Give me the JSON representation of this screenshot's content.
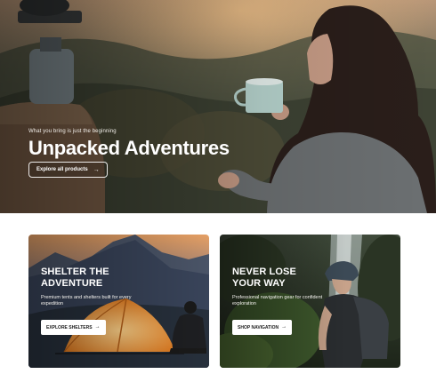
{
  "hero": {
    "eyebrow": "What you bring is just the beginning",
    "title": "Unpacked Adventures",
    "button_label": "Explore all products",
    "button_icon": "arrow-right-icon"
  },
  "cards": [
    {
      "title_line1": "SHELTER THE",
      "title_line2": "ADVENTURE",
      "description": "Premium tents and shelters built for every expedition",
      "button_label": "EXPLORE SHELTERS",
      "button_icon": "arrow-right-icon"
    },
    {
      "title_line1": "NEVER LOSE",
      "title_line2": "YOUR WAY",
      "description": "Professional navigation gear for confident exploration",
      "button_label": "SHOP NAVIGATION",
      "button_icon": "arrow-right-icon"
    }
  ],
  "colors": {
    "text_light": "#ffffff",
    "button_dark_text": "#1b1b1b",
    "tent_glow": "#f2a03a",
    "sky_sunset": "#e8a25f"
  }
}
